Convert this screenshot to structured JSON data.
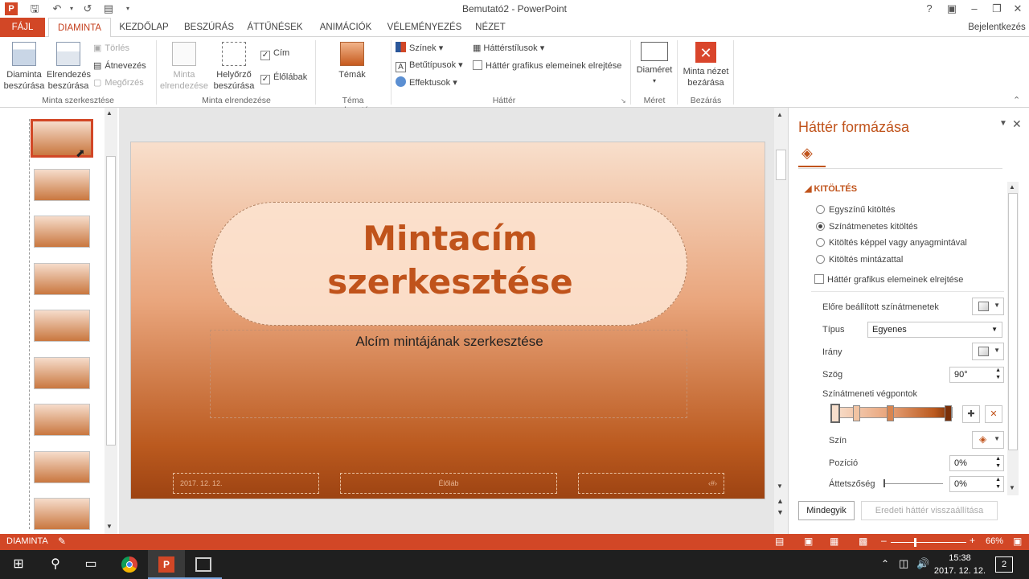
{
  "window": {
    "title": "Bemutató2 - PowerPoint",
    "signin": "Bejelentkezés",
    "help": "?"
  },
  "tabs": [
    {
      "label": "FÁJL"
    },
    {
      "label": "DIAMINTA"
    },
    {
      "label": "KEZDŐLAP"
    },
    {
      "label": "BESZÚRÁS"
    },
    {
      "label": "ÁTTŰNÉSEK"
    },
    {
      "label": "ANIMÁCIÓK"
    },
    {
      "label": "VÉLEMÉNYEZÉS"
    },
    {
      "label": "NÉZET"
    }
  ],
  "ribbon": {
    "edit_master": {
      "insert_master": "Diaminta beszúrása",
      "insert_layout": "Elrendezés beszúrása",
      "delete": "Törlés",
      "rename": "Átnevezés",
      "preserve": "Megőrzés",
      "group": "Minta szerkesztése"
    },
    "master_layout": {
      "master_layout_btn": "Minta elrendezése",
      "insert_placeholder": "Helyőrző beszúrása",
      "title_chk": "Cím",
      "footers_chk": "Élőlábak",
      "group": "Minta elrendezése"
    },
    "theme": {
      "themes": "Témák",
      "group": "Téma szerkesztése"
    },
    "background": {
      "colors": "Színek",
      "fonts": "Betűtípusok",
      "effects": "Effektusok",
      "bg_styles": "Háttérstílusok",
      "hide_bg": "Háttér grafikus elemeinek elrejtése",
      "group": "Háttér"
    },
    "size": {
      "slide_size": "Diaméret",
      "group": "Méret"
    },
    "close": {
      "close_master": "Minta nézet bezárása",
      "group": "Bezárás"
    }
  },
  "slide": {
    "title_line1": "Mintacím",
    "title_line2": "szerkesztése",
    "subtitle": "Alcím mintájának szerkesztése",
    "date": "2017. 12. 12.",
    "footer": "Élőláb",
    "number": "‹#›"
  },
  "pane": {
    "title": "Háttér formázása",
    "section": "KITÖLTÉS",
    "fill_options": [
      "Egyszínű kitöltés",
      "Színátmenetes kitöltés",
      "Kitöltés képpel vagy anyagmintával",
      "Kitöltés mintázattal"
    ],
    "selected_fill": 1,
    "hide_graphics": "Háttér grafikus elemeinek elrejtése",
    "preset": "Előre beállított színátmenetek",
    "type_label": "Típus",
    "type_value": "Egyenes",
    "direction": "Irány",
    "angle_label": "Szög",
    "angle_value": "90°",
    "stops_label": "Színátmeneti végpontok",
    "color_label": "Szín",
    "position_label": "Pozíció",
    "position_value": "0%",
    "transparency_label": "Áttetszőség",
    "transparency_value": "0%",
    "apply_all": "Mindegyik",
    "reset": "Eredeti háttér visszaállítása"
  },
  "status": {
    "view": "DIAMINTA",
    "zoom": "66%"
  },
  "taskbar": {
    "time": "15:38",
    "date": "2017. 12. 12.",
    "notifications": "2"
  },
  "colors": {
    "accent": "#d24726",
    "title": "#c0531b"
  }
}
